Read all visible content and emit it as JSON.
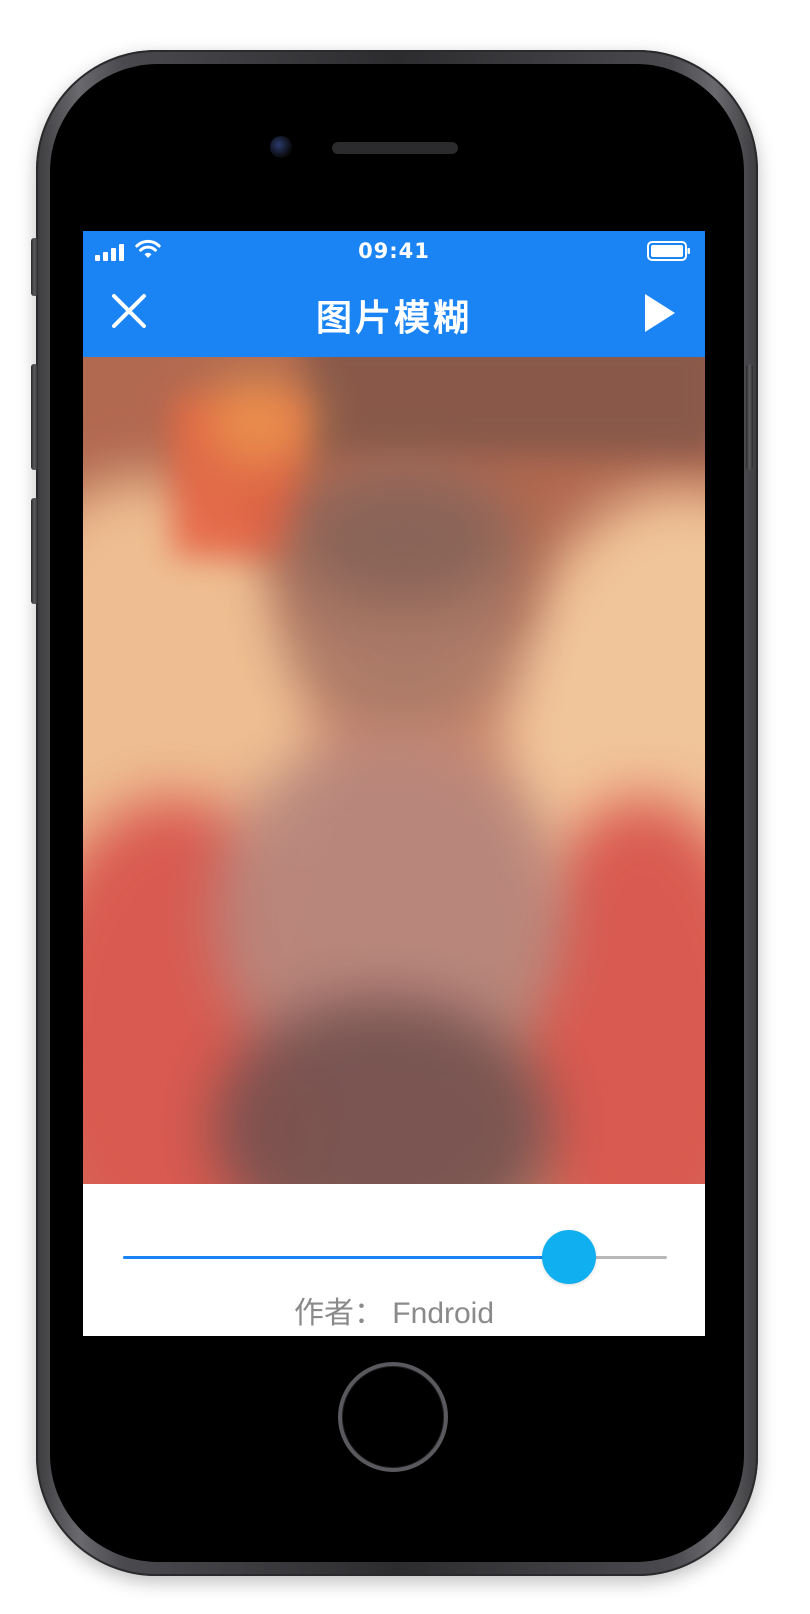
{
  "status_bar": {
    "time": "09:41",
    "icons": [
      "cellular-signal-icon",
      "wifi-icon",
      "battery-icon"
    ]
  },
  "app_bar": {
    "title": "图片模糊",
    "leading_icon": "close-icon",
    "trailing_icon": "play-icon",
    "background_color": "#1a84f5"
  },
  "image": {
    "description_icon": "blurred-photo",
    "blurred": true
  },
  "blur_slider": {
    "value_fraction": 0.82,
    "active_color": "#1a84f5",
    "thumb_color": "#10aff0",
    "inactive_color": "#b8b8b8"
  },
  "footer": {
    "author_text": "作者： Fndroid"
  }
}
